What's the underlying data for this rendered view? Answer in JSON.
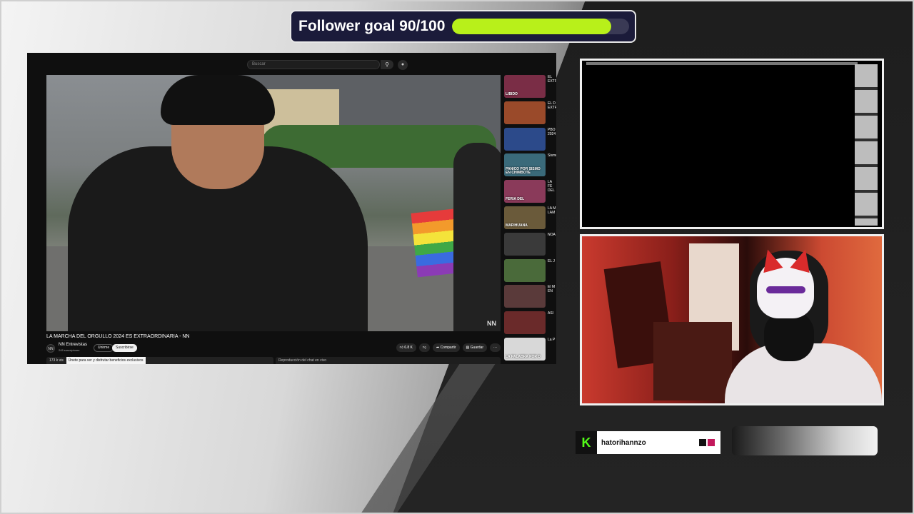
{
  "follower_goal": {
    "text": "Follower goal 90/100",
    "progress_fraction": 0.9,
    "fill_color": "#b8f01a"
  },
  "youtube": {
    "search_placeholder": "Buscar",
    "video_title": "LA MARCHA DEL ORGULLO 2024 ES EXTRAORDINARIA - NN",
    "watermark": "NN",
    "channel": {
      "avatar_text": "NN",
      "name": "NN Entrevistas",
      "subscribers": "245 suscriptores"
    },
    "join_label": "Unirme",
    "subscribe_label": "Suscribirse",
    "actions": {
      "likes": "6.8 K",
      "share": "Compartir",
      "save": "Guardar",
      "more": "···"
    },
    "description_prefix": "173 k vis",
    "description_highlight": "Únete para ver y disfrutar beneficios exclusivos",
    "chat_replay": "Reproducción del chat en vivo",
    "recommendations": [
      {
        "thumb_text": "LIBIDO",
        "title": "EL EXTR",
        "color": "#7a2d46"
      },
      {
        "thumb_text": "",
        "title": "EL D EXTR",
        "color": "#9a4a2a"
      },
      {
        "thumb_text": "",
        "title": "PBO 2024",
        "color": "#2c4a8a"
      },
      {
        "thumb_text": "PANICO POR SISMO EN CHIMBOTE",
        "title": "Sismo",
        "color": "#3a6a7a"
      },
      {
        "thumb_text": "FERIA DEL",
        "title": "LA FE DEL",
        "color": "#8a3a5a"
      },
      {
        "thumb_text": "MARIHUANA",
        "title": "LA M LAM",
        "color": "#6a5a3a"
      },
      {
        "thumb_text": "",
        "title": "NOA",
        "color": "#3a3a3a"
      },
      {
        "thumb_text": "",
        "title": "EL J",
        "color": "#4a6a3a"
      },
      {
        "thumb_text": "",
        "title": "El M EN",
        "color": "#5a3a3a"
      },
      {
        "thumb_text": "",
        "title": "ASI",
        "color": "#6a2a2a"
      },
      {
        "thumb_text": "LA PALABRA POR D",
        "title": "La P",
        "color": "#d8d8d8"
      },
      {
        "thumb_text": "",
        "title": "NAC",
        "color": "#4a4a4a"
      }
    ]
  },
  "kick": {
    "logo": "K",
    "username": "hatorihannzo",
    "accent": "#53fc18"
  }
}
